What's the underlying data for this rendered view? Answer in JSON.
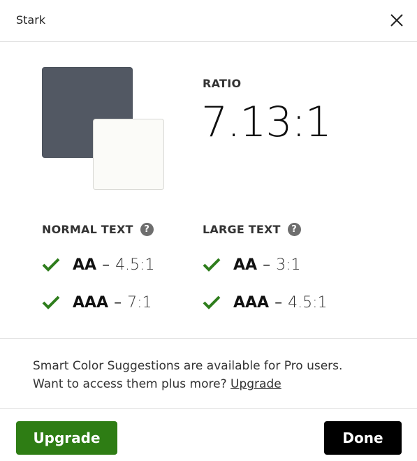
{
  "header": {
    "title": "Stark",
    "close_icon": "close-icon"
  },
  "colors": {
    "foreground": "#525863",
    "background": "#fbfbf8",
    "pass": "#2e7d1c",
    "upgrade": "#2e7d14",
    "done": "#000000"
  },
  "ratio": {
    "label": "RATIO",
    "value": "7.13:1"
  },
  "normal_text": {
    "heading": "NORMAL TEXT",
    "help_icon": "help-icon",
    "rows": [
      {
        "level": "AA",
        "dash": "–",
        "requirement": "4.5:1",
        "status": "pass"
      },
      {
        "level": "AAA",
        "dash": "–",
        "requirement": "7:1",
        "status": "pass"
      }
    ]
  },
  "large_text": {
    "heading": "LARGE TEXT",
    "help_icon": "help-icon",
    "rows": [
      {
        "level": "AA",
        "dash": "–",
        "requirement": "3:1",
        "status": "pass"
      },
      {
        "level": "AAA",
        "dash": "–",
        "requirement": "4.5:1",
        "status": "pass"
      }
    ]
  },
  "promo": {
    "line1": "Smart Color Suggestions are available for Pro users.",
    "line2": "Want to access them plus more?",
    "link": "Upgrade"
  },
  "footer": {
    "upgrade_label": "Upgrade",
    "done_label": "Done"
  }
}
